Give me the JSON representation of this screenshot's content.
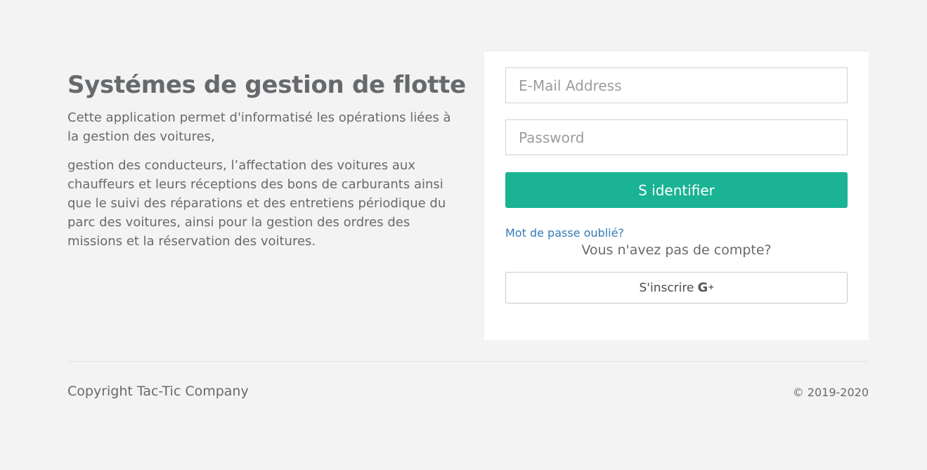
{
  "intro": {
    "title": "Systémes de gestion de flotte",
    "paragraph1": "Cette application permet d'informatisé les opérations liées à la gestion des voitures,",
    "paragraph2": "gestion des conducteurs, l’affectation des voitures aux chauffeurs et leurs réceptions des bons de carburants ainsi que le suivi des réparations et des entretiens périodique du parc des voitures, ainsi pour la gestion des ordres des missions et la réservation des voitures."
  },
  "login": {
    "email_placeholder": "E-Mail Address",
    "email_value": "",
    "password_placeholder": "Password",
    "password_value": "",
    "submit_label": "S identifier",
    "forgot_label": "Mot de passe oublié?",
    "no_account_text": "Vous n'avez pas de compte?",
    "register_label": "S'inscrire",
    "register_icon": "google-plus-icon"
  },
  "footer": {
    "copyright": "Copyright Tac-Tic Company",
    "years": "© 2019-2020"
  },
  "colors": {
    "background": "#f3f3f4",
    "primary": "#1ab394",
    "link": "#337ab7",
    "text": "#676a6c"
  }
}
